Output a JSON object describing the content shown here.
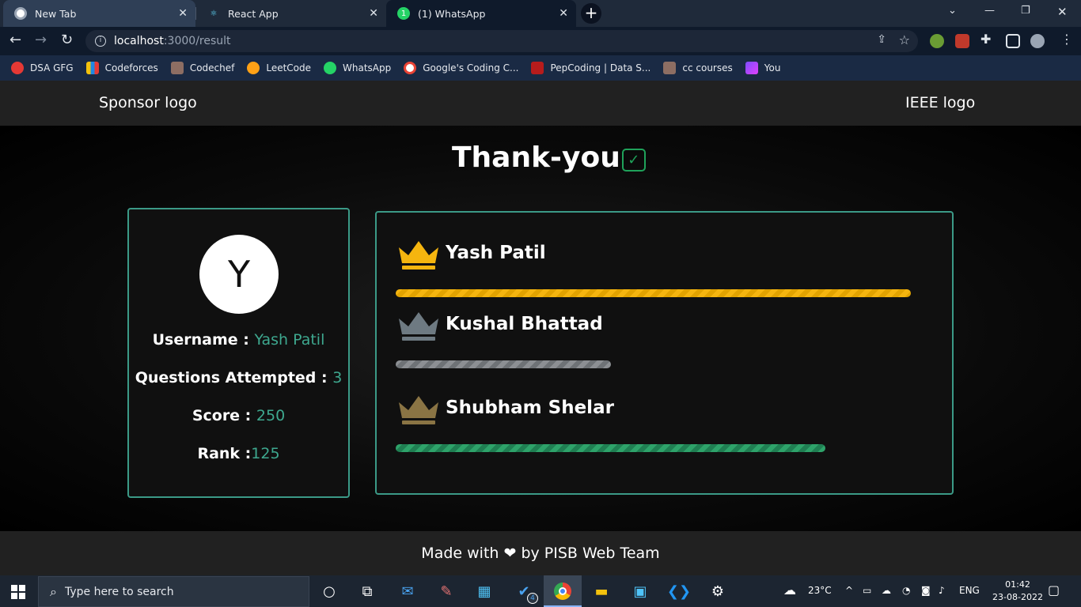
{
  "browser": {
    "tabs": [
      {
        "label": "New Tab"
      },
      {
        "label": "React App"
      },
      {
        "label": "(1) WhatsApp"
      }
    ],
    "url_host": "localhost",
    "url_rest": ":3000/result",
    "bookmarks": [
      {
        "label": "DSA GFG"
      },
      {
        "label": "Codeforces"
      },
      {
        "label": "Codechef"
      },
      {
        "label": "LeetCode"
      },
      {
        "label": "WhatsApp"
      },
      {
        "label": "Google's Coding C..."
      },
      {
        "label": "PepCoding | Data S..."
      },
      {
        "label": "cc courses"
      },
      {
        "label": "You"
      }
    ]
  },
  "header": {
    "sponsor_logo": "Sponsor logo",
    "ieee_logo": "IEEE logo"
  },
  "title": "Thank-you",
  "profile": {
    "avatar_letter": "Y",
    "username_label": "Username : ",
    "username": "Yash Patil",
    "questions_label": "Questions Attempted : ",
    "questions": "3",
    "score_label": "Score : ",
    "score": "250",
    "rank_label": "Rank :",
    "rank": "125"
  },
  "leaderboard": [
    {
      "name": "Yash Patil",
      "crown_color": "#f5b50f",
      "bar_fraction": 1.0,
      "bar_style": "gold"
    },
    {
      "name": "Kushal Bhattad",
      "crown_color": "#6e7a82",
      "bar_fraction": 0.418,
      "bar_style": "silver"
    },
    {
      "name": "Shubham Shelar",
      "crown_color": "#8a7444",
      "bar_fraction": 0.834,
      "bar_style": "green"
    }
  ],
  "footer": {
    "made_prefix": "Made with",
    "made_suffix": "by PISB Web Team"
  },
  "taskbar": {
    "search_placeholder": "Type here to search",
    "badge": "4",
    "weather": "23°C",
    "lang": "ENG",
    "time": "01:42",
    "date": "23-08-2022"
  }
}
